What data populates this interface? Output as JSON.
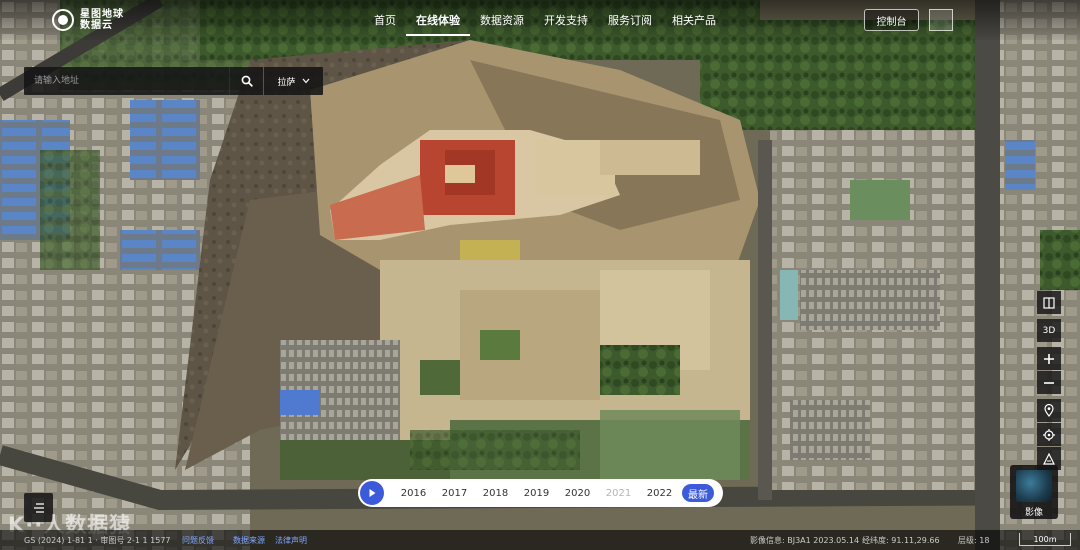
{
  "header": {
    "logo_line1": "星图地球",
    "logo_line2": "数据云",
    "nav": [
      {
        "label": "首页",
        "active": false
      },
      {
        "label": "在线体验",
        "active": true
      },
      {
        "label": "数据资源",
        "active": false
      },
      {
        "label": "开发支持",
        "active": false
      },
      {
        "label": "服务订阅",
        "active": false
      },
      {
        "label": "相关产品",
        "active": false
      }
    ],
    "console_label": "控制台"
  },
  "search": {
    "placeholder": "请输入地址",
    "region_label": "拉萨",
    "search_icon": "search-icon",
    "dropdown_icon": "chevron-down-icon"
  },
  "toolbar": {
    "items": [
      {
        "name": "compare-tool",
        "icon": "split-view-icon",
        "label": ""
      },
      {
        "name": "3d-toggle",
        "icon": "3d-icon",
        "label": "3D"
      },
      {
        "name": "zoom-in",
        "icon": "plus-icon",
        "label": "+"
      },
      {
        "name": "zoom-out",
        "icon": "minus-icon",
        "label": "−"
      },
      {
        "name": "location",
        "icon": "location-pin-icon",
        "label": ""
      },
      {
        "name": "locate-me",
        "icon": "target-icon",
        "label": ""
      },
      {
        "name": "measure",
        "icon": "measure-icon",
        "label": ""
      }
    ],
    "layer_label": "影像"
  },
  "timeline": {
    "years": [
      {
        "label": "2016",
        "enabled": true
      },
      {
        "label": "2017",
        "enabled": true
      },
      {
        "label": "2018",
        "enabled": true
      },
      {
        "label": "2019",
        "enabled": true
      },
      {
        "label": "2020",
        "enabled": true
      },
      {
        "label": "2021",
        "enabled": false
      },
      {
        "label": "2022",
        "enabled": true
      }
    ],
    "latest_label": "最新"
  },
  "watermark": "K··人数据猿",
  "statusbar": {
    "copyright": "GS (2024) 1-81 1 · 审图号 2-1 1 1577",
    "feedback": "问题反馈",
    "data_source": "数据来源",
    "legal": "法律声明",
    "image_info": "影像信息: BJ3A1 2023.05.14",
    "coords": "经纬度: 91.11,29.66",
    "level": "层级: 18",
    "scale": "100m"
  },
  "colors": {
    "accent": "#3b5bdb",
    "panel": "#141414"
  }
}
